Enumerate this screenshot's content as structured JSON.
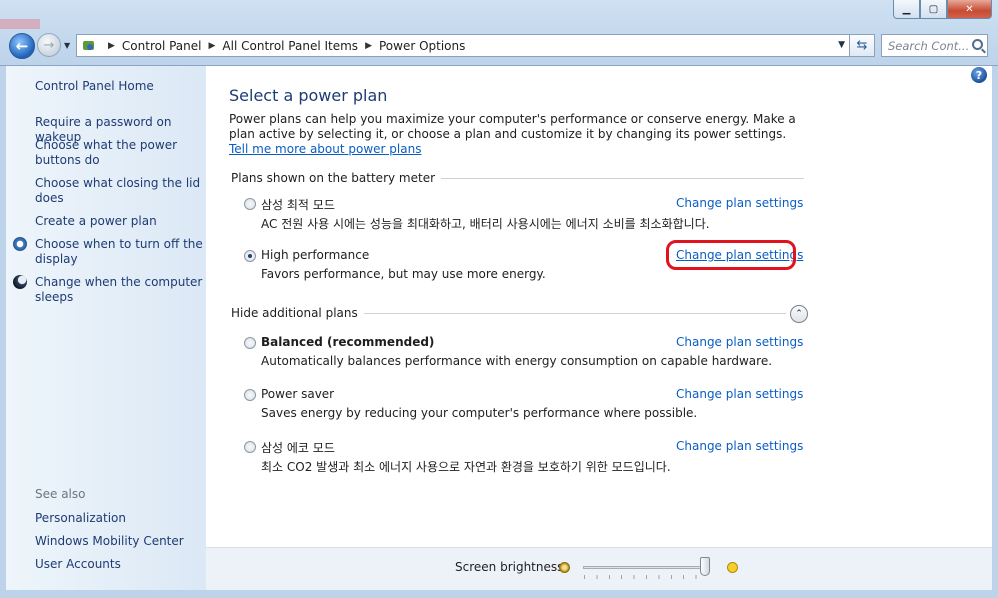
{
  "window": {
    "minimize_glyph": "▁",
    "maximize_glyph": "▢",
    "close_glyph": "✕"
  },
  "address": {
    "breadcrumbs": [
      "Control Panel",
      "All Control Panel Items",
      "Power Options"
    ],
    "search_placeholder": "Search Cont..."
  },
  "sidebar": {
    "home": "Control Panel Home",
    "tasks": [
      "Require a password on wakeup",
      "Choose what the power buttons do",
      "Choose what closing the lid does",
      "Create a power plan",
      "Choose when to turn off the display",
      "Change when the computer sleeps"
    ],
    "see_also_label": "See also",
    "see_also": [
      "Personalization",
      "Windows Mobility Center",
      "User Accounts"
    ]
  },
  "main": {
    "title": "Select a power plan",
    "description": "Power plans can help you maximize your computer's performance or conserve energy. Make a plan active by selecting it, or choose a plan and customize it by changing its power settings.",
    "learn_more": "Tell me more about power plans",
    "battery_group_label": "Plans shown on the battery meter",
    "hidden_group_label": "Hide additional plans",
    "change_label": "Change plan settings",
    "plans_battery": [
      {
        "name": "삼성 최적 모드",
        "desc": "AC 전원 사용 시에는 성능을 최대화하고, 배터리 사용시에는 에너지 소비를 최소화합니다.",
        "checked": false
      },
      {
        "name": "High performance",
        "desc": "Favors performance, but may use more energy.",
        "checked": true
      }
    ],
    "plans_hidden": [
      {
        "name": "Balanced (recommended)",
        "desc": "Automatically balances performance with energy consumption on capable hardware.",
        "checked": false
      },
      {
        "name": "Power saver",
        "desc": "Saves energy by reducing your computer's performance where possible.",
        "checked": false
      },
      {
        "name": "삼성 에코 모드",
        "desc": "최소 CO2 발생과 최소 에너지 사용으로 자연과 환경을 보호하기 위한 모드입니다.",
        "checked": false
      }
    ]
  },
  "brightness": {
    "label": "Screen brightness:",
    "level": 1.0
  }
}
